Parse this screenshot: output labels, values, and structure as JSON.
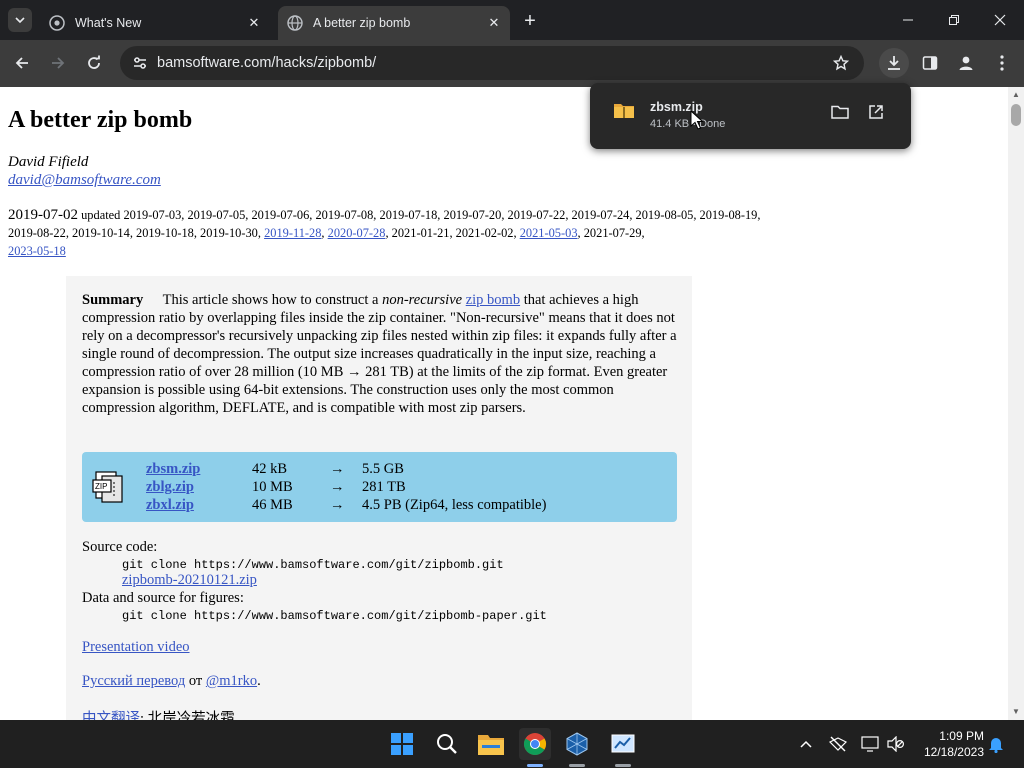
{
  "browser": {
    "tabs": [
      {
        "title": "What's New",
        "active": false
      },
      {
        "title": "A better zip bomb",
        "active": true
      }
    ],
    "url": "bamsoftware.com/hacks/zipbomb/"
  },
  "download_bubble": {
    "filename": "zbsm.zip",
    "meta": "41.4 KB • Done"
  },
  "article": {
    "title": "A better zip bomb",
    "author": "David Fifield",
    "email": "david@bamsoftware.com",
    "date": "2019-07-02",
    "updated_label": "updated",
    "updated_dates": "2019-07-03, 2019-07-05, 2019-07-06, 2019-07-08, 2019-07-18, 2019-07-20, 2019-07-22, 2019-07-24, 2019-08-05, 2019-08-19, 2019-08-22, 2019-10-14, 2019-10-18, 2019-10-30,",
    "linked_dates": [
      "2019-11-28",
      "2020-07-28"
    ],
    "dates_mid": "2021-01-21, 2021-02-02,",
    "linked_date_3": "2021-05-03",
    "date_after_3": "2021-07-29,",
    "linked_date_4": "2023-05-18",
    "summary_label": "Summary",
    "summary_p1": "This article shows how to construct a",
    "summary_em": "non-recursive",
    "summary_link": "zip bomb",
    "summary_p2": "that achieves a high compression ratio by overlapping files inside the zip container. \"Non-recursive\" means that it does not rely on a decompressor's recursively unpacking zip files nested within zip files: it expands fully after a single round of decompression. The output size increases quadratically in the input size, reaching a compression ratio of over 28 million (10 MB → 281 TB) at the limits of the zip format. Even greater expansion is possible using 64-bit extensions. The construction uses only the most common compression algorithm, DEFLATE, and is compatible with most zip parsers.",
    "downloads": [
      {
        "name": "zbsm.zip",
        "size": "42 kB",
        "arrow": "→",
        "output": "5.5 GB"
      },
      {
        "name": "zblg.zip",
        "size": "10 MB",
        "arrow": "→",
        "output": "281 TB"
      },
      {
        "name": "zbxl.zip",
        "size": "46 MB",
        "arrow": "→",
        "output": "4.5 PB (Zip64, less compatible)"
      }
    ],
    "source_label": "Source code:",
    "source_cmd": "git clone https://www.bamsoftware.com/git/zipbomb.git",
    "source_zip": "zipbomb-20210121.zip",
    "data_label": "Data and source for figures:",
    "data_cmd": "git clone https://www.bamsoftware.com/git/zipbomb-paper.git",
    "video_link": "Presentation video",
    "russian_link": "Русский перевод",
    "russian_ot": "от",
    "russian_author": "@m1rko",
    "russian_period": ".",
    "chinese_link": "中文翻译",
    "chinese_rest": ": 北岸冷若冰霜"
  },
  "taskbar": {
    "time": "1:09 PM",
    "date": "12/18/2023"
  }
}
